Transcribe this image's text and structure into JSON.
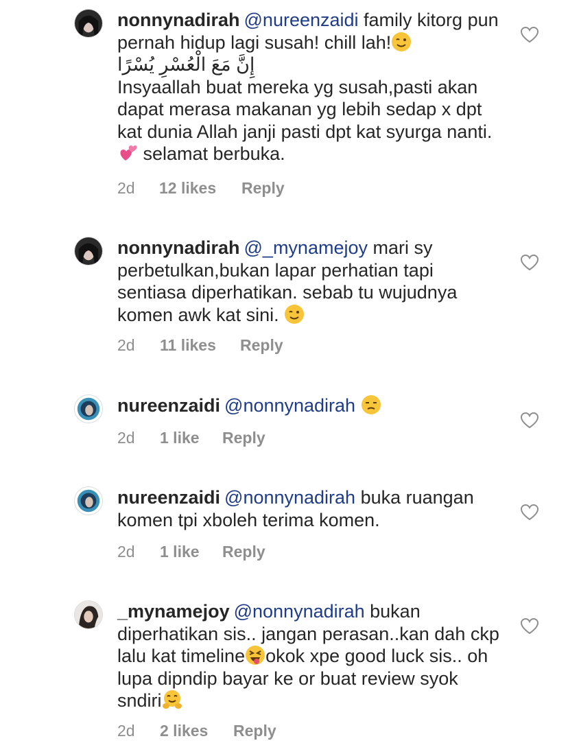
{
  "comments": [
    {
      "username": "nonnynadirah",
      "mention": "@nureenzaidi",
      "line1_rest": " family kitorg pun pernah hidup lagi susah! chill lah!",
      "emoji1": "wink-emoji",
      "arabic": "إِنَّ مَعَ الْعُسْرِ يُسْرًا",
      "text2": "Insyaallah buat mereka yg susah,pasti akan dapat merasa makanan yg lebih sedap x dpt kat dunia Allah janji pasti dpt kat syurga nanti.",
      "emoji2": "two-hearts-emoji",
      "text3": " selamat berbuka.",
      "time": "2d",
      "likes": "12 likes",
      "reply": "Reply"
    },
    {
      "username": "nonnynadirah",
      "mention": "@_mynamejoy",
      "text": " mari sy perbetulkan,bukan lapar perhatian tapi sentiasa diperhatikan. sebab tu wujudnya komen awk kat sini.",
      "emoji": "wink-emoji",
      "time": "2d",
      "likes": "11 likes",
      "reply": "Reply"
    },
    {
      "username": "nureenzaidi",
      "mention": "@nonnynadirah",
      "text": "",
      "emoji": "unamused-emoji",
      "time": "2d",
      "likes": "1 like",
      "reply": "Reply"
    },
    {
      "username": "nureenzaidi",
      "mention": "@nonnynadirah",
      "text": " buka ruangan komen tpi xboleh terima komen.",
      "time": "2d",
      "likes": "1 like",
      "reply": "Reply"
    },
    {
      "username": "_mynamejoy",
      "mention": "@nonnynadirah",
      "text1": " bukan diperhatikan sis.. jangan perasan..kan dah ckp lalu kat timeline",
      "emoji1": "tongue-wink-emoji",
      "text2": "okok xpe good luck sis.. oh lupa dipndip bayar ke or buat review syok sndiri",
      "emoji2": "hugging-emoji",
      "time": "2d",
      "likes": "2 likes",
      "reply": "Reply"
    }
  ]
}
